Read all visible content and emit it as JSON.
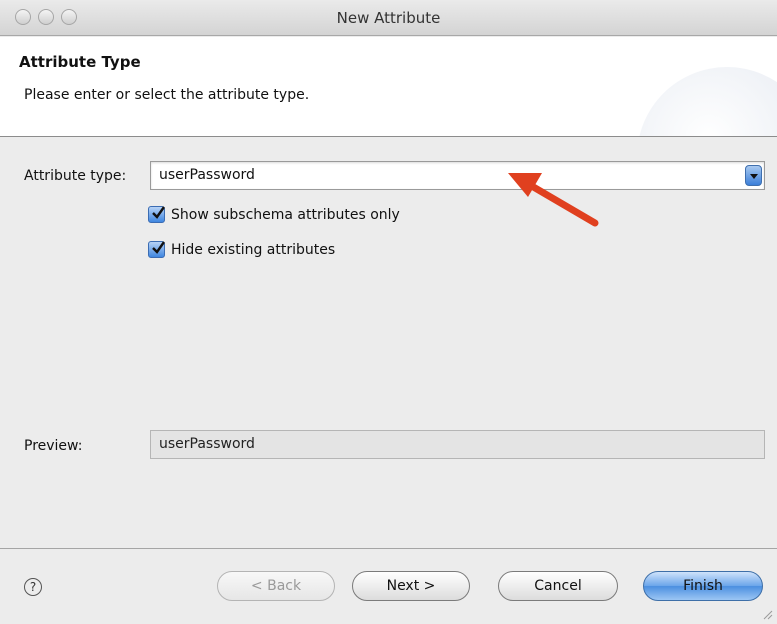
{
  "window": {
    "title": "New Attribute"
  },
  "banner": {
    "title": "Attribute Type",
    "description": "Please enter or select the attribute type."
  },
  "form": {
    "attribute_type_label": "Attribute type:",
    "attribute_type_value": "userPassword",
    "show_subschema_label": "Show subschema attributes only",
    "show_subschema_checked": true,
    "hide_existing_label": "Hide existing attributes",
    "hide_existing_checked": true,
    "preview_label": "Preview:",
    "preview_value": "userPassword"
  },
  "footer": {
    "help_glyph": "?",
    "back_label": "< Back",
    "next_label": "Next >",
    "cancel_label": "Cancel",
    "finish_label": "Finish"
  },
  "colors": {
    "accent": "#3f86e0",
    "annotation_arrow": "#e0401f"
  }
}
